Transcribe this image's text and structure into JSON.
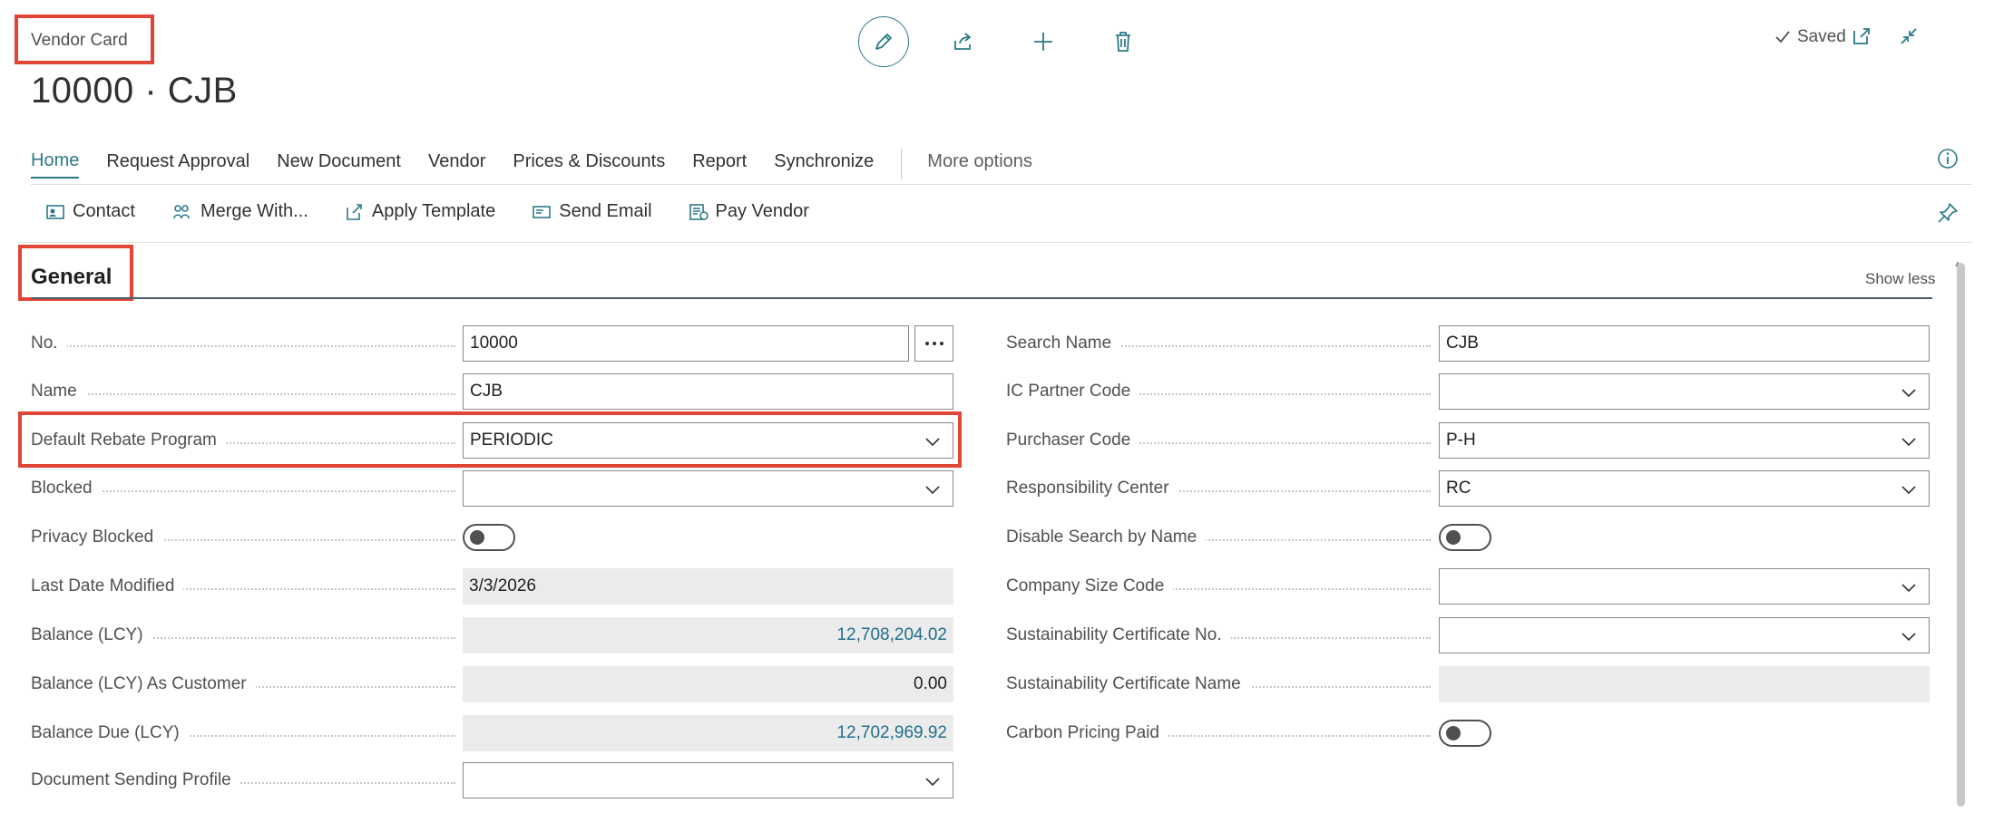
{
  "page": {
    "caption": "Vendor Card",
    "title": "10000 · CJB",
    "saved_label": "Saved"
  },
  "top_actions": [
    "edit-icon",
    "share-icon",
    "add-icon",
    "delete-icon"
  ],
  "tabs": [
    {
      "label": "Home",
      "active": true
    },
    {
      "label": "Request Approval"
    },
    {
      "label": "New Document"
    },
    {
      "label": "Vendor"
    },
    {
      "label": "Prices & Discounts"
    },
    {
      "label": "Report"
    },
    {
      "label": "Synchronize"
    },
    {
      "label": "More options"
    }
  ],
  "actions": [
    {
      "label": "Contact",
      "icon": "contact-card-icon"
    },
    {
      "label": "Merge With...",
      "icon": "merge-icon"
    },
    {
      "label": "Apply Template",
      "icon": "apply-template-icon"
    },
    {
      "label": "Send Email",
      "icon": "email-icon"
    },
    {
      "label": "Pay Vendor",
      "icon": "payment-icon"
    }
  ],
  "section": {
    "title": "General",
    "toggle_label": "Show less"
  },
  "left_fields": [
    {
      "label": "No.",
      "value": "10000",
      "type": "text-assist"
    },
    {
      "label": "Name",
      "value": "CJB",
      "type": "text"
    },
    {
      "label": "Default Rebate Program",
      "value": "PERIODIC",
      "type": "select"
    },
    {
      "label": "Blocked",
      "value": "",
      "type": "select"
    },
    {
      "label": "Privacy Blocked",
      "value": "",
      "type": "toggle"
    },
    {
      "label": "Last Date Modified",
      "value": "3/3/2026",
      "type": "readonly"
    },
    {
      "label": "Balance (LCY)",
      "value": "12,708,204.02",
      "type": "readonly-link"
    },
    {
      "label": "Balance (LCY) As Customer",
      "value": "0.00",
      "type": "readonly-num"
    },
    {
      "label": "Balance Due (LCY)",
      "value": "12,702,969.92",
      "type": "readonly-link"
    },
    {
      "label": "Document Sending Profile",
      "value": "",
      "type": "select"
    }
  ],
  "right_fields": [
    {
      "label": "Search Name",
      "value": "CJB",
      "type": "text"
    },
    {
      "label": "IC Partner Code",
      "value": "",
      "type": "select"
    },
    {
      "label": "Purchaser Code",
      "value": "P-H",
      "type": "select"
    },
    {
      "label": "Responsibility Center",
      "value": "RC",
      "type": "select"
    },
    {
      "label": "Disable Search by Name",
      "value": "",
      "type": "toggle"
    },
    {
      "label": "Company Size Code",
      "value": "",
      "type": "select"
    },
    {
      "label": "Sustainability Certificate No.",
      "value": "",
      "type": "select"
    },
    {
      "label": "Sustainability Certificate Name",
      "value": "",
      "type": "readonly"
    },
    {
      "label": "Carbon Pricing Paid",
      "value": "",
      "type": "toggle"
    }
  ],
  "colors": {
    "accent": "#2b7a8a",
    "highlight": "#e04535",
    "link": "#1f6f8b"
  }
}
